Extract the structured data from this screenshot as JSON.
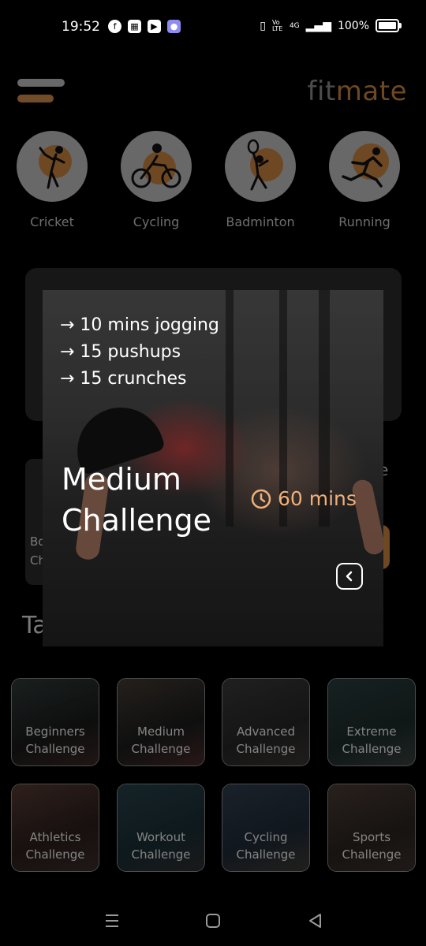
{
  "status_bar": {
    "time": "19:52",
    "battery": "100%",
    "network": "4G",
    "volte": "Vo LTE"
  },
  "header": {
    "brand_fit": "fit",
    "brand_mate": "mate",
    "brand_colors": {
      "fit": "#8a8a8a",
      "mate": "#c9843f"
    }
  },
  "sports": [
    {
      "label": "Cricket",
      "icon": "cricket-icon"
    },
    {
      "label": "Cycling",
      "icon": "cycling-icon"
    },
    {
      "label": "Badminton",
      "icon": "badminton-icon"
    },
    {
      "label": "Running",
      "icon": "running-icon"
    }
  ],
  "background_partial": {
    "left_card_line1": "Bo",
    "left_card_line2": "Ch",
    "section_partial": "Ta",
    "right_partial": "e"
  },
  "challenges": [
    {
      "line1": "Beginners",
      "line2": "Challenge"
    },
    {
      "line1": "Medium",
      "line2": "Challenge"
    },
    {
      "line1": "Advanced",
      "line2": "Challenge"
    },
    {
      "line1": "Extreme",
      "line2": "Challenge"
    },
    {
      "line1": "Athletics",
      "line2": "Challenge"
    },
    {
      "line1": "Workout",
      "line2": "Challenge"
    },
    {
      "line1": "Cycling",
      "line2": "Challenge"
    },
    {
      "line1": "Sports",
      "line2": "Challenge"
    }
  ],
  "modal": {
    "steps": [
      "→ 10 mins jogging",
      "→ 15 pushups",
      "→ 15 crunches"
    ],
    "title_line1": "Medium",
    "title_line2": "Challenge",
    "duration": "60 mins",
    "accent": "#f0b07a"
  },
  "nav": {
    "recents_icon": "recents-icon",
    "home_icon": "home-icon",
    "back_icon": "back-triangle-icon"
  }
}
